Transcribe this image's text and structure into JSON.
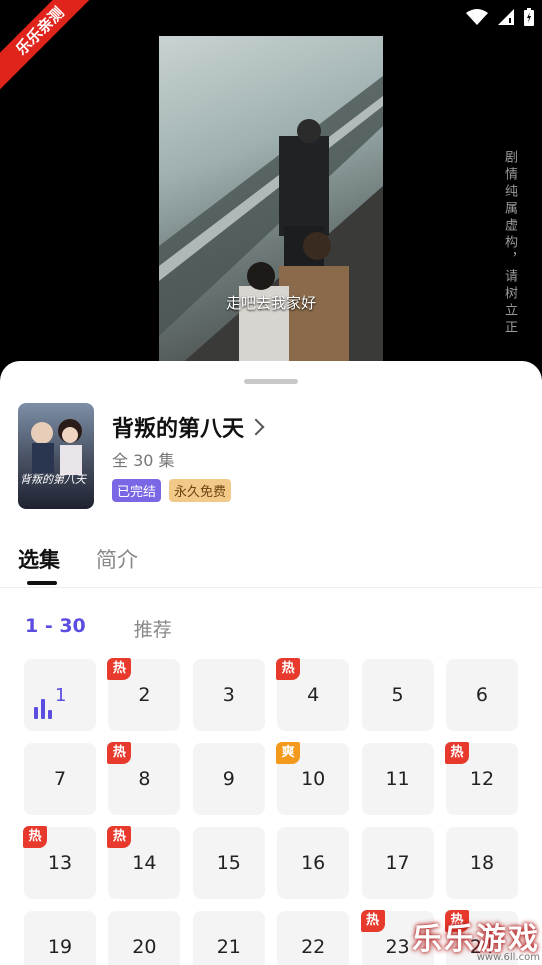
{
  "corner_badge": "乐乐亲测",
  "video": {
    "subtitle": "走吧去我家好",
    "side_note": "剧情纯属虚构，请树立正"
  },
  "status_icons": [
    "wifi-icon",
    "signal-icon",
    "battery-icon"
  ],
  "drama": {
    "title": "背叛的第八天",
    "episode_count": "全 30 集",
    "poster_text": "背叛的第八天",
    "tags": [
      "已完结",
      "永久免费"
    ]
  },
  "tabs": [
    "选集",
    "简介"
  ],
  "ranges": [
    "1 - 30",
    "推荐"
  ],
  "episodes": [
    {
      "n": "1",
      "badge": ""
    },
    {
      "n": "2",
      "badge": "热"
    },
    {
      "n": "3",
      "badge": ""
    },
    {
      "n": "4",
      "badge": "热"
    },
    {
      "n": "5",
      "badge": ""
    },
    {
      "n": "6",
      "badge": ""
    },
    {
      "n": "7",
      "badge": ""
    },
    {
      "n": "8",
      "badge": "热"
    },
    {
      "n": "9",
      "badge": ""
    },
    {
      "n": "10",
      "badge": "爽"
    },
    {
      "n": "11",
      "badge": ""
    },
    {
      "n": "12",
      "badge": "热"
    },
    {
      "n": "13",
      "badge": "热"
    },
    {
      "n": "14",
      "badge": "热"
    },
    {
      "n": "15",
      "badge": ""
    },
    {
      "n": "16",
      "badge": ""
    },
    {
      "n": "17",
      "badge": ""
    },
    {
      "n": "18",
      "badge": ""
    },
    {
      "n": "19",
      "badge": ""
    },
    {
      "n": "20",
      "badge": ""
    },
    {
      "n": "21",
      "badge": ""
    },
    {
      "n": "22",
      "badge": ""
    },
    {
      "n": "23",
      "badge": "热"
    },
    {
      "n": "24",
      "badge": "热"
    }
  ],
  "watermark": {
    "main": "乐乐游戏",
    "url": "www.6ll.com"
  },
  "colors": {
    "accent": "#5b4de0",
    "hot": "#e83a2c",
    "cool": "#f39a1c"
  }
}
